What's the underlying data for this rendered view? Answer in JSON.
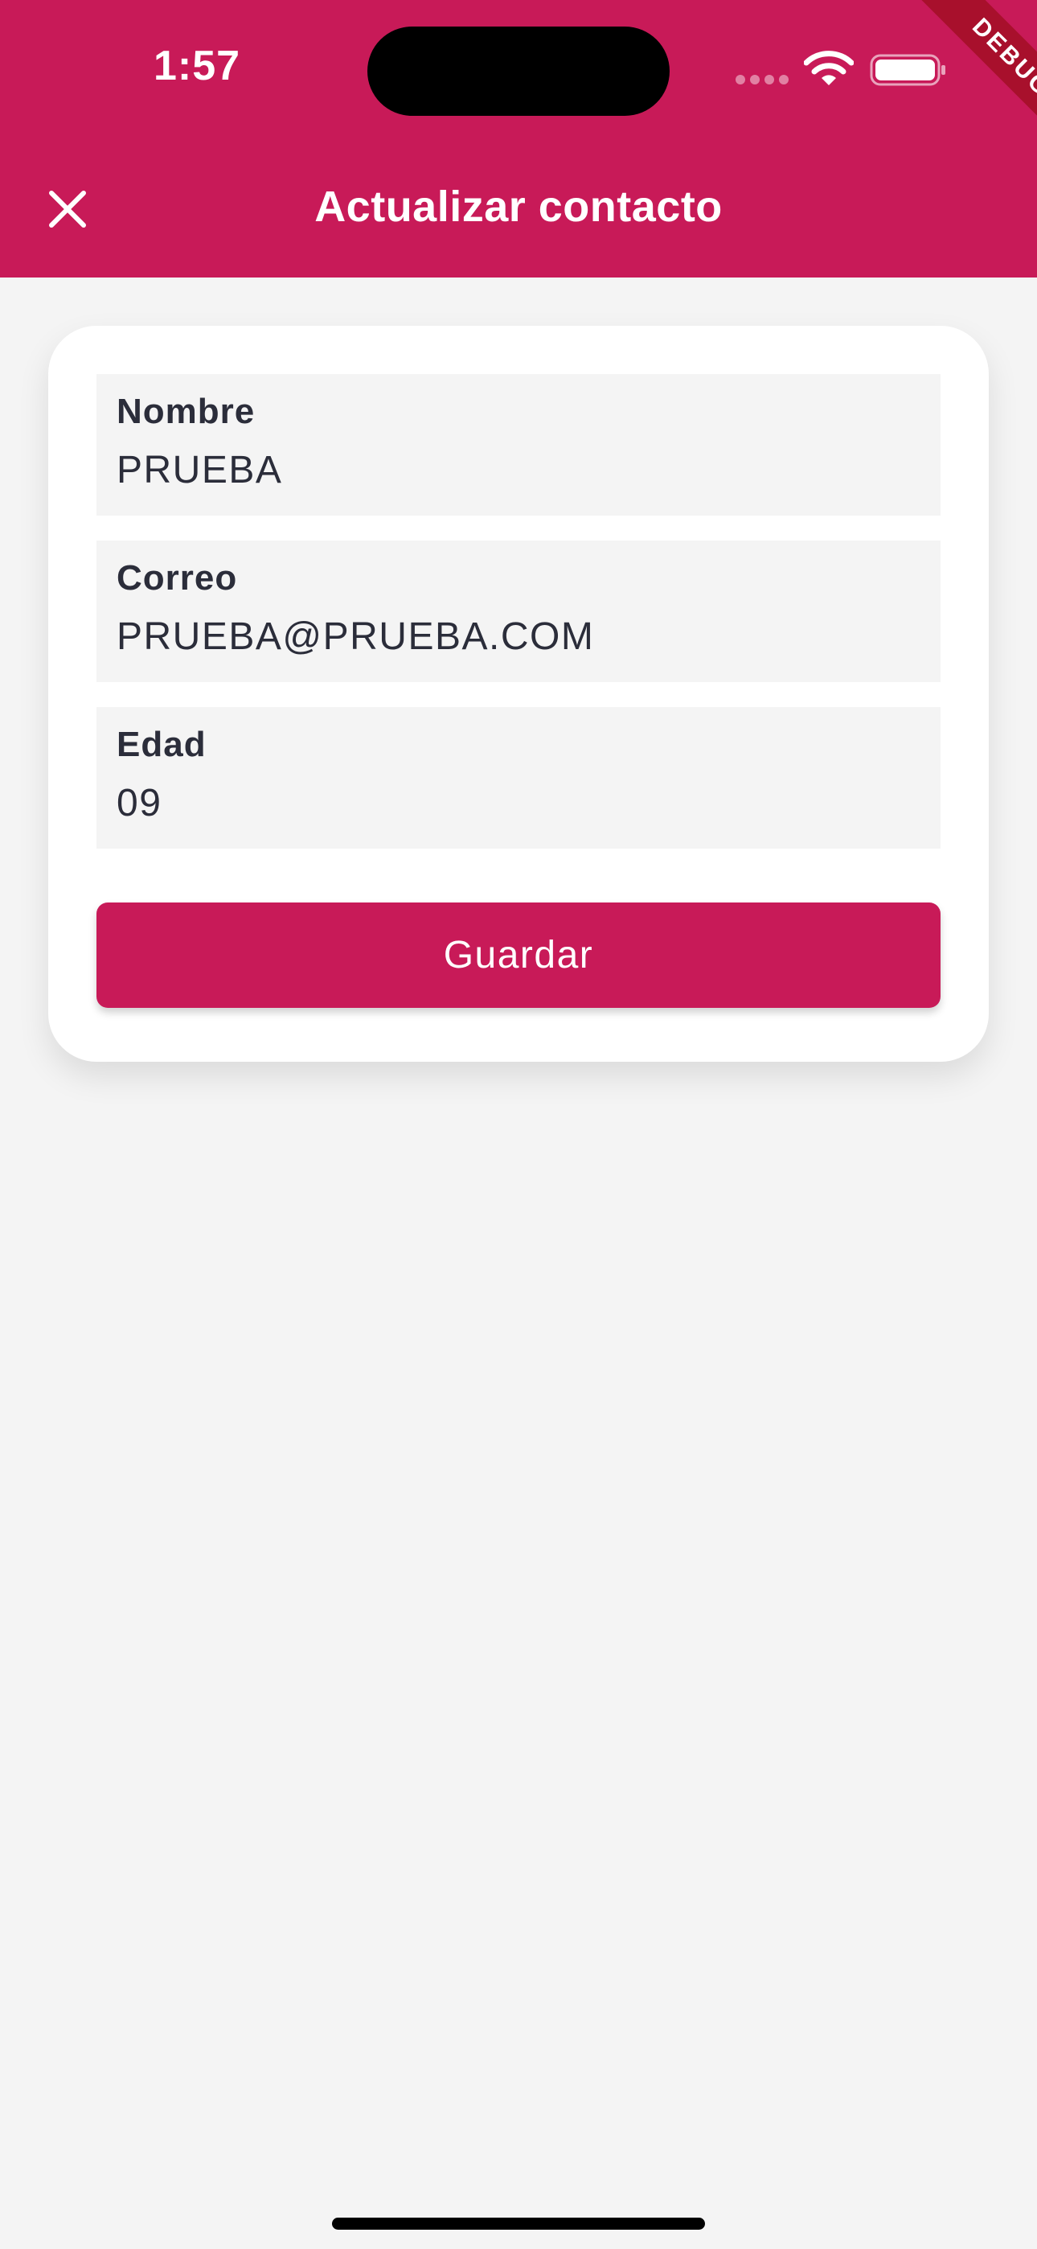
{
  "status_bar": {
    "time": "1:57",
    "icons": [
      "cellular-signal-icon",
      "wifi-icon",
      "battery-icon"
    ]
  },
  "debug_banner": "DEBUG",
  "appbar": {
    "title": "Actualizar contacto",
    "close_icon": "close-icon"
  },
  "form": {
    "fields": [
      {
        "label": "Nombre",
        "value": "PRUEBA"
      },
      {
        "label": "Correo",
        "value": "PRUEBA@PRUEBA.COM"
      },
      {
        "label": "Edad",
        "value": "09"
      }
    ],
    "save_label": "Guardar"
  },
  "colors": {
    "primary": "#c81a58",
    "background": "#f4f4f4",
    "card": "#ffffff",
    "field_fill": "#f4f4f4",
    "text": "#2b2d3a",
    "debug_ribbon": "#a8102c"
  }
}
